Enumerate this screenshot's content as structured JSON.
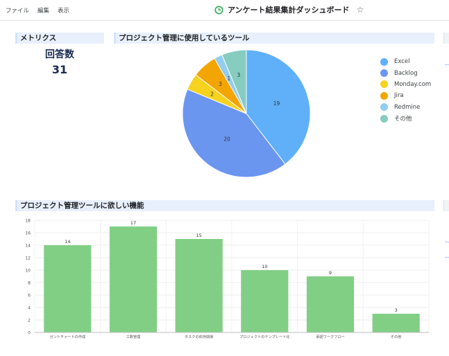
{
  "menu": {
    "file": "ファイル",
    "edit": "編集",
    "view": "表示"
  },
  "header": {
    "title": "アンケート結果集計ダッシュボード"
  },
  "metrics": {
    "section_title": "メトリクス",
    "label": "回答数",
    "value": "31"
  },
  "pie_section": {
    "title": "プロジェクト管理に使用しているツール"
  },
  "bar_section": {
    "title": "プロジェクト管理ツールに欲しい機能"
  },
  "colors": {
    "excel": "#5fb0f8",
    "backlog": "#6b96f0",
    "monday": "#f7d21e",
    "jira": "#f2a503",
    "redmine": "#92cdf1",
    "other": "#86ccbf",
    "bar": "#81cf85",
    "section_bg": "#e8f0fe",
    "title_icon": "#34a853"
  },
  "icons": {
    "title": "clock-icon",
    "star": "star-outline-icon"
  },
  "chart_data": [
    {
      "type": "pie",
      "categories": [
        "Excel",
        "Backlog",
        "Monday.com",
        "Jira",
        "Redmine",
        "その他"
      ],
      "values": [
        19,
        20,
        2,
        3,
        1,
        3
      ],
      "labels": [
        "19",
        "20",
        "2",
        "3",
        "1",
        "3"
      ],
      "legend": "right",
      "title": "プロジェクト管理に使用しているツール"
    },
    {
      "type": "bar",
      "categories": [
        "ガントチャートの作成",
        "工数管理",
        "タスクの依存関係",
        "プロジェクトのテンプレート化",
        "承認ワークフロー",
        "その他"
      ],
      "values": [
        14,
        17,
        15,
        10,
        9,
        3
      ],
      "ylim": [
        0,
        18
      ],
      "yticks": [
        "0",
        "2",
        "4",
        "6",
        "8",
        "10",
        "12",
        "14",
        "16",
        "18"
      ],
      "grid": true,
      "title": "プロジェクト管理ツールに欲しい機能"
    }
  ]
}
